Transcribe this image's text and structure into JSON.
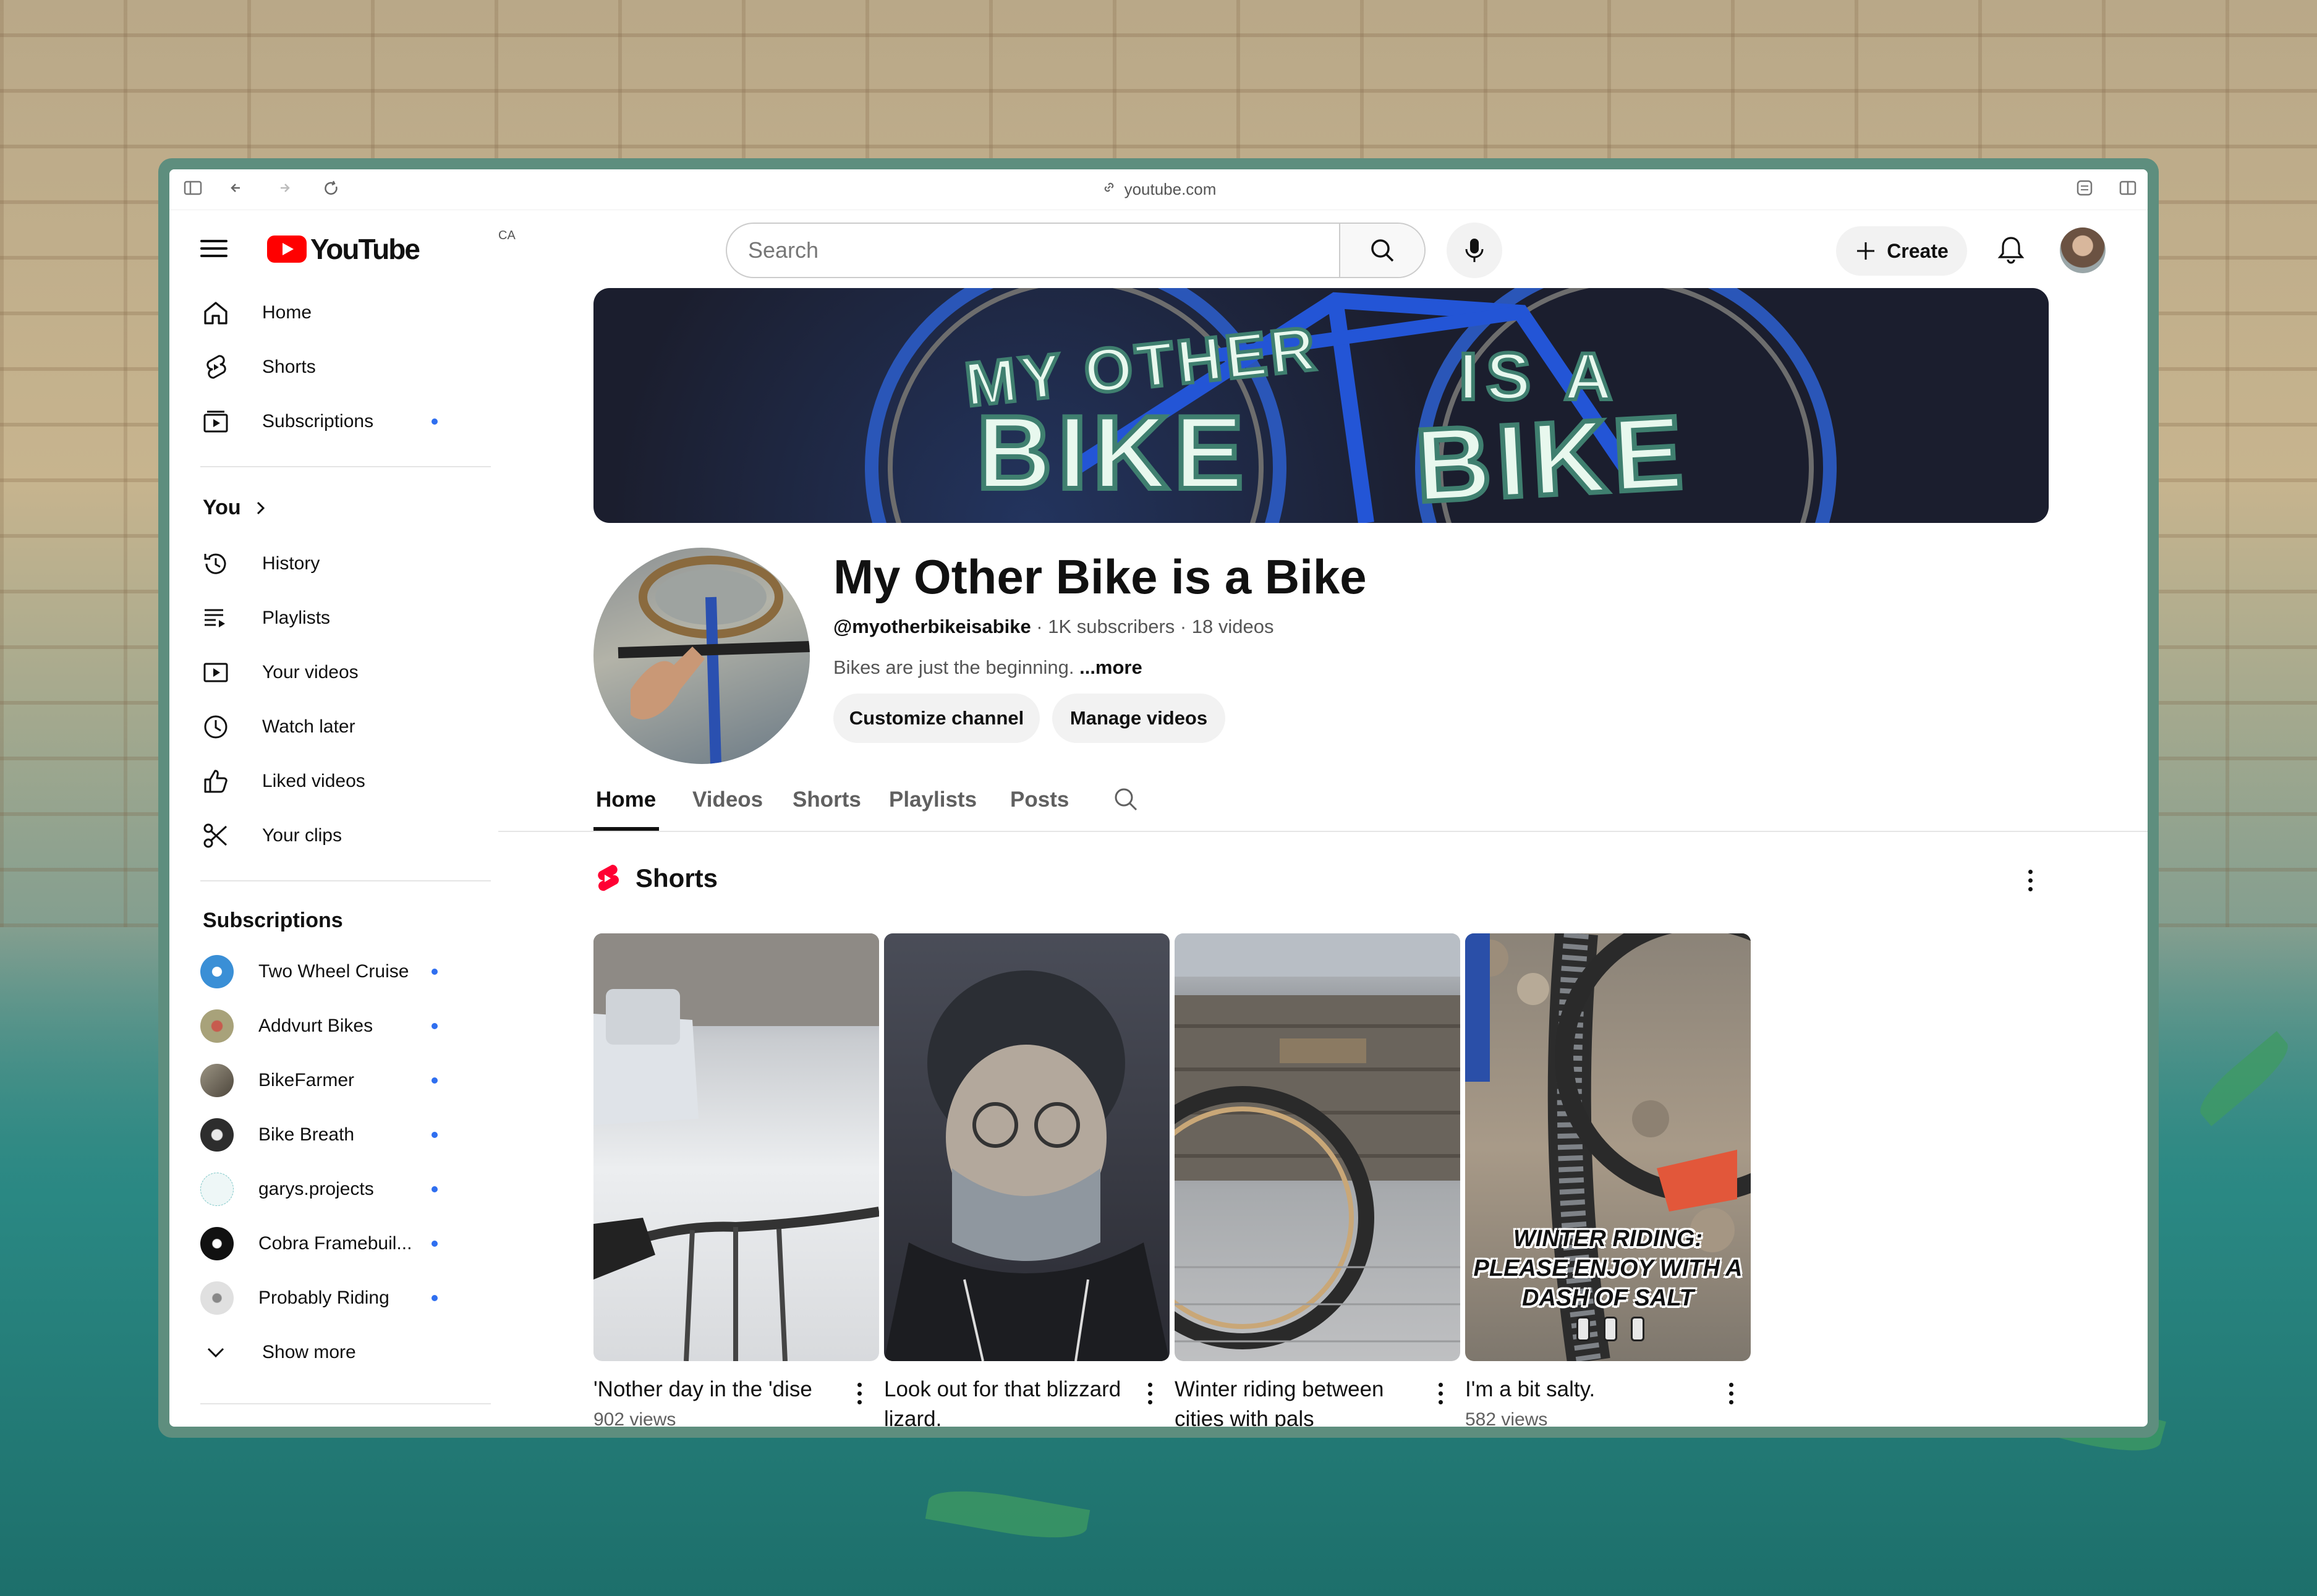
{
  "browser": {
    "url": "youtube.com"
  },
  "header": {
    "logo_text": "YouTube",
    "country_code": "CA",
    "search_placeholder": "Search",
    "create_label": "Create"
  },
  "sidebar": {
    "primary": [
      {
        "label": "Home",
        "icon": "home-icon"
      },
      {
        "label": "Shorts",
        "icon": "shorts-icon"
      },
      {
        "label": "Subscriptions",
        "icon": "subscriptions-icon",
        "dot": true
      }
    ],
    "you_title": "You",
    "you_items": [
      {
        "label": "History",
        "icon": "history-icon"
      },
      {
        "label": "Playlists",
        "icon": "playlists-icon"
      },
      {
        "label": "Your videos",
        "icon": "your-videos-icon"
      },
      {
        "label": "Watch later",
        "icon": "watch-later-icon"
      },
      {
        "label": "Liked videos",
        "icon": "liked-videos-icon"
      },
      {
        "label": "Your clips",
        "icon": "clips-icon"
      }
    ],
    "subs_title": "Subscriptions",
    "subs": [
      {
        "label": "Two Wheel Cruise",
        "color": "#3a8fd6"
      },
      {
        "label": "Addvurt Bikes",
        "color": "#a8a27a"
      },
      {
        "label": "BikeFarmer",
        "color": "#6b6455"
      },
      {
        "label": "Bike Breath",
        "color": "#2d2d2d"
      },
      {
        "label": "garys.projects",
        "color": "#cfe9ea"
      },
      {
        "label": "Cobra Framebuil...",
        "color": "#111111"
      },
      {
        "label": "Probably Riding",
        "color": "#d9d9d9"
      }
    ],
    "show_more": "Show more"
  },
  "banner": {
    "line1": "MY OTHER",
    "line2": "BIKE",
    "line3": "IS A",
    "line4": "BIKE"
  },
  "channel": {
    "name": "My Other Bike is a Bike",
    "handle": "@myotherbikeisabike",
    "stats": " · 1K subscribers · 18 videos",
    "description": "Bikes are just the beginning. ",
    "more": "...more",
    "customize_label": "Customize channel",
    "manage_label": "Manage videos"
  },
  "tabs": [
    "Home",
    "Videos",
    "Shorts",
    "Playlists",
    "Posts"
  ],
  "shorts_section": {
    "title": "Shorts",
    "items": [
      {
        "title": "'Nother day in the 'dise",
        "views": "902 views"
      },
      {
        "title": "Look out for that blizzard lizard.",
        "views": ""
      },
      {
        "title": "Winter riding between cities with pals",
        "views": ""
      },
      {
        "title": "I'm a bit salty.",
        "views": "582 views",
        "overlay": [
          "WINTER RIDING:",
          "PLEASE ENJOY WITH A",
          "DASH OF SALT"
        ]
      }
    ]
  }
}
